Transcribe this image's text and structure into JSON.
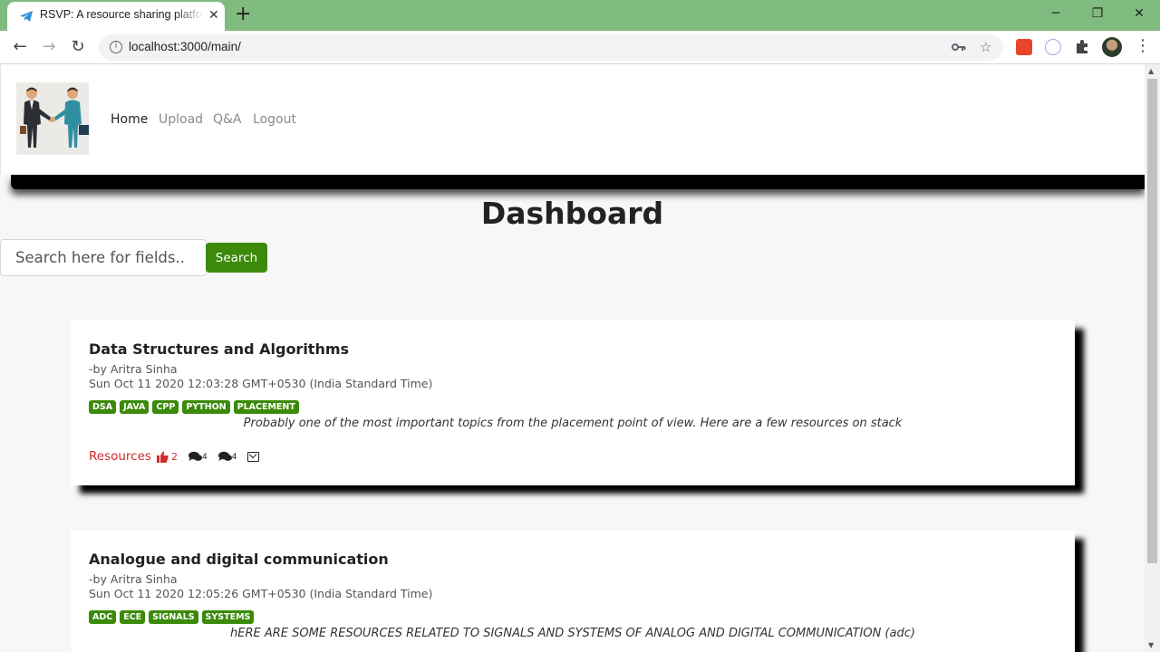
{
  "browser": {
    "tab_title": "RSVP: A resource sharing platform",
    "tab_close": "✕",
    "new_tab": "+",
    "url": "localhost:3000/main/",
    "window": {
      "minimize": "─",
      "restore": "❐",
      "close": "✕"
    }
  },
  "nav": {
    "links": [
      {
        "label": "Home",
        "active": true
      },
      {
        "label": "Upload",
        "active": false
      },
      {
        "label": "Q&A",
        "active": false
      },
      {
        "label": "Logout",
        "active": false
      }
    ]
  },
  "page": {
    "title": "Dashboard"
  },
  "search": {
    "placeholder": "Search here for fields..",
    "button": "Search"
  },
  "posts": [
    {
      "title": "Data Structures and Algorithms",
      "author": "-by Aritra Sinha",
      "date": "Sun Oct 11 2020 12:03:28 GMT+0530 (India Standard Time)",
      "tags": [
        "DSA",
        "JAVA",
        "CPP",
        "PYTHON",
        "PLACEMENT"
      ],
      "description": "Probably one of the most important topics from the placement point of view. Here are a few resources on stack",
      "resources_label": "Resources",
      "likes": "2",
      "comments": "4",
      "replies": "4"
    },
    {
      "title": "Analogue and digital communication",
      "author": "-by Aritra Sinha",
      "date": "Sun Oct 11 2020 12:05:26 GMT+0530 (India Standard Time)",
      "tags": [
        "ADC",
        "ECE",
        "SIGNALS",
        "SYSTEMS"
      ],
      "description": "hERE ARE SOME RESOURCES RELATED TO SIGNALS AND SYSTEMS OF ANALOG AND DIGITAL COMMUNICATION (adc)"
    }
  ],
  "colors": {
    "accent_green": "#3b8a0a",
    "resource_red": "#d12b2b",
    "tab_bar": "#80bb7f"
  }
}
